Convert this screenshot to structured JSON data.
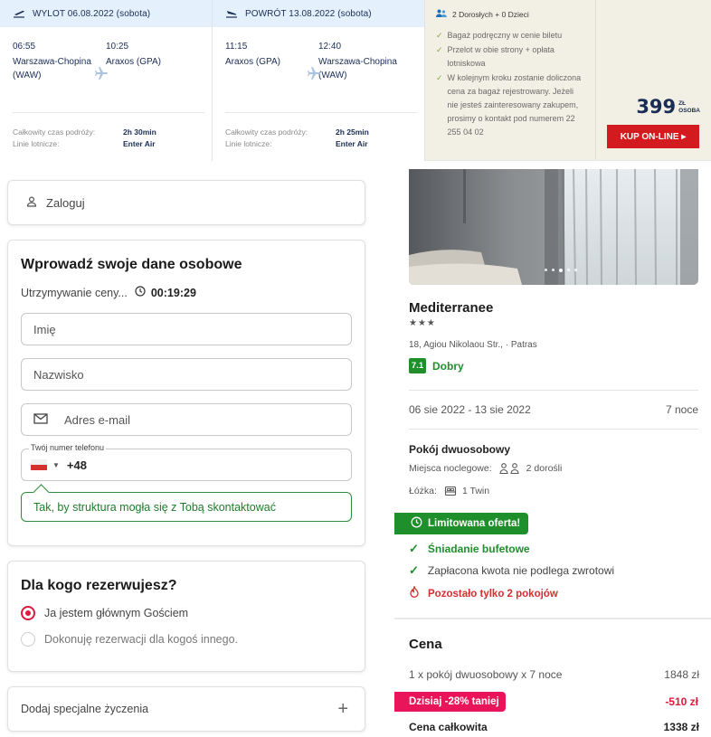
{
  "flight": {
    "outbound": {
      "header": "WYLOT 06.08.2022 (sobota)",
      "dep_time": "06:55",
      "dep_place": "Warszawa-Chopina (WAW)",
      "arr_time": "10:25",
      "arr_place": "Araxos (GPA)",
      "duration_label": "Całkowity czas podróży:",
      "duration": "2h 30min",
      "airline_label": "Linie lotnicze:",
      "airline": "Enter Air"
    },
    "return": {
      "header": "POWRÓT 13.08.2022 (sobota)",
      "dep_time": "11:15",
      "dep_place": "Araxos (GPA)",
      "arr_time": "12:40",
      "arr_place": "Warszawa-Chopina (WAW)",
      "duration_label": "Całkowity czas podróży:",
      "duration": "2h 25min",
      "airline_label": "Linie lotnicze:",
      "airline": "Enter Air"
    },
    "passengers": "2 Dorosłych + 0 Dzieci",
    "benefits": [
      "Bagaż podręczny w cenie biletu",
      "Przelot w obie strony + opłata lotniskowa",
      "W kolejnym kroku zostanie doliczona cena za bagaż rejestrowany. Jeżeli nie jesteś zainteresowany zakupem, prosimy o kontakt pod numerem 22 255 04 02"
    ],
    "price": "399",
    "price_currency": "ZŁ",
    "price_unit": "OSOBA",
    "buy_button": "KUP ON-LINE ▸"
  },
  "login": {
    "label": "Zaloguj"
  },
  "personal": {
    "title": "Wprowadź swoje dane osobowe",
    "hold_label": "Utrzymywanie ceny...",
    "timer": "00:19:29",
    "first_name_placeholder": "Imię",
    "last_name_placeholder": "Nazwisko",
    "email_placeholder": "Adres e-mail",
    "phone_legend": "Twój numer telefonu",
    "phone_prefix": "+48",
    "hint": "Tak, by struktura mogła się z Tobą skontaktować"
  },
  "booking_for": {
    "title": "Dla kogo rezerwujesz?",
    "options": [
      "Ja jestem głównym Gościem",
      "Dokonuję rezerwacji dla kogoś innego."
    ],
    "selected": 0
  },
  "special_requests": {
    "label": "Dodaj specjalne życzenia",
    "plus": "+"
  },
  "hotel": {
    "name": "Mediterranee",
    "stars": "★★★",
    "address": "18, Agiou Nikolaou Str., · Patras",
    "rating": "7.1",
    "rating_label": "Dobry",
    "dates": "06 sie 2022 - 13 sie 2022",
    "nights": "7 noce",
    "room_title": "Pokój dwuosobowy",
    "sleeping_label": "Miejsca noclegowe:",
    "sleeping_value": "2 dorośli",
    "beds_label": "Łóżka:",
    "beds_value": "1 Twin",
    "limited_offer": "Limitowana oferta!",
    "breakfast": "Śniadanie bufetowe",
    "nonrefundable": "Zapłacona kwota nie podlega zwrotowi",
    "rooms_left": "Pozostało tylko 2 pokojów"
  },
  "price_summary": {
    "title": "Cena",
    "line_label": "1 x pokój dwuosobowy x 7 noce",
    "line_value": "1848 zł",
    "promo_label": "Dzisiaj -28% taniej",
    "promo_value": "-510 zł",
    "total_label": "Cena całkowita",
    "total_value": "1338 zł"
  },
  "colors": {
    "accent_green": "#1f8f2c",
    "accent_red": "#d21a1f",
    "promo_pink": "#e8155a",
    "flight_header_bg": "#e4f0fb",
    "benefits_bg": "#f2efe4"
  }
}
